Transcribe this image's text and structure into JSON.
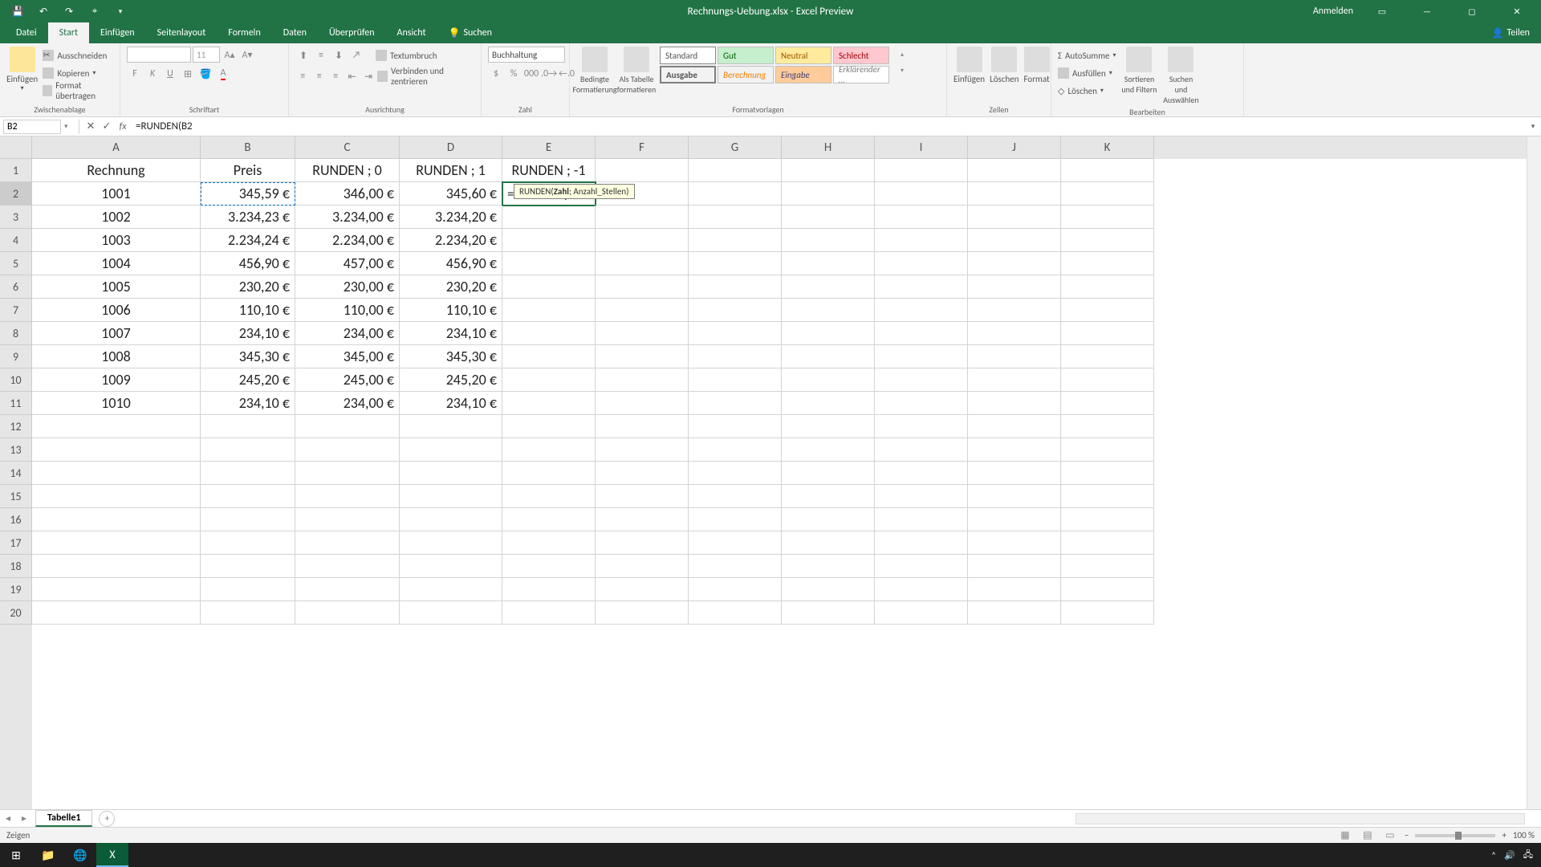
{
  "titlebar": {
    "title": "Rechnungs-Uebung.xlsx - Excel Preview",
    "anmelden": "Anmelden"
  },
  "tabs": {
    "datei": "Datei",
    "start": "Start",
    "einfuegen": "Einfügen",
    "seitenlayout": "Seitenlayout",
    "formeln": "Formeln",
    "daten": "Daten",
    "ueberpruefen": "Überprüfen",
    "ansicht": "Ansicht",
    "suchen": "Suchen",
    "teilen": "Teilen"
  },
  "ribbon": {
    "einfuegen": "Einfügen",
    "ausschneiden": "Ausschneiden",
    "kopieren": "Kopieren",
    "format_uebertragen": "Format übertragen",
    "schriftart": "Schriftart",
    "fontsize": "11",
    "ausrichtung": "Ausrichtung",
    "textumbruch": "Textumbruch",
    "verbinden": "Verbinden und zentrieren",
    "zahl": "Zahl",
    "buchhaltung": "Buchhaltung",
    "bedingte": "Bedingte Formatierung",
    "alstabelle": "Als Tabelle formatieren",
    "formatvorlagen": "Formatvorlagen",
    "standard": "Standard",
    "gut": "Gut",
    "neutral": "Neutral",
    "schlecht": "Schlecht",
    "ausgabe": "Ausgabe",
    "berechnung": "Berechnung",
    "eingabe": "Eingabe",
    "erklar": "Erklärender …",
    "zellen": "Zellen",
    "zelle_einfuegen": "Einfügen",
    "loeschen": "Löschen",
    "format": "Format",
    "bearbeiten": "Bearbeiten",
    "autosumme": "AutoSumme",
    "ausfuellen": "Ausfüllen",
    "loeschen2": "Löschen",
    "sortieren": "Sortieren und Filtern",
    "suchen": "Suchen und Auswählen"
  },
  "formula_bar": {
    "name_box": "B2",
    "formula": "=RUNDEN(B2"
  },
  "columns": [
    "A",
    "B",
    "C",
    "D",
    "E",
    "F",
    "G",
    "H",
    "I",
    "J",
    "K"
  ],
  "col_widths": [
    "cw-A",
    "cw-B",
    "cw-C",
    "cw-D",
    "cw-E",
    "cw-F",
    "cw-G",
    "cw-H",
    "cw-I",
    "cw-J",
    "cw-K"
  ],
  "headers": [
    "Rechnung",
    "Preis",
    "RUNDEN ; 0",
    "RUNDEN ; 1",
    "RUNDEN ; -1"
  ],
  "edit_cell": {
    "prefix": "=RUNDEN(",
    "ref": "B2"
  },
  "tooltip": {
    "func": "RUNDEN(",
    "arg1": "Zahl",
    "rest": "; Anzahl_Stellen)"
  },
  "data_rows": [
    {
      "a": "1001",
      "b": "345,59 €",
      "c": "346,00 €",
      "d": "345,60 €"
    },
    {
      "a": "1002",
      "b": "3.234,23 €",
      "c": "3.234,00 €",
      "d": "3.234,20 €"
    },
    {
      "a": "1003",
      "b": "2.234,24 €",
      "c": "2.234,00 €",
      "d": "2.234,20 €"
    },
    {
      "a": "1004",
      "b": "456,90 €",
      "c": "457,00 €",
      "d": "456,90 €"
    },
    {
      "a": "1005",
      "b": "230,20 €",
      "c": "230,00 €",
      "d": "230,20 €"
    },
    {
      "a": "1006",
      "b": "110,10 €",
      "c": "110,00 €",
      "d": "110,10 €"
    },
    {
      "a": "1007",
      "b": "234,10 €",
      "c": "234,00 €",
      "d": "234,10 €"
    },
    {
      "a": "1008",
      "b": "345,30 €",
      "c": "345,00 €",
      "d": "345,30 €"
    },
    {
      "a": "1009",
      "b": "245,20 €",
      "c": "245,00 €",
      "d": "245,20 €"
    },
    {
      "a": "1010",
      "b": "234,10 €",
      "c": "234,00 €",
      "d": "234,10 €"
    }
  ],
  "sheet_tab": "Tabelle1",
  "status": {
    "left": "Zeigen",
    "zoom": "100 %"
  }
}
